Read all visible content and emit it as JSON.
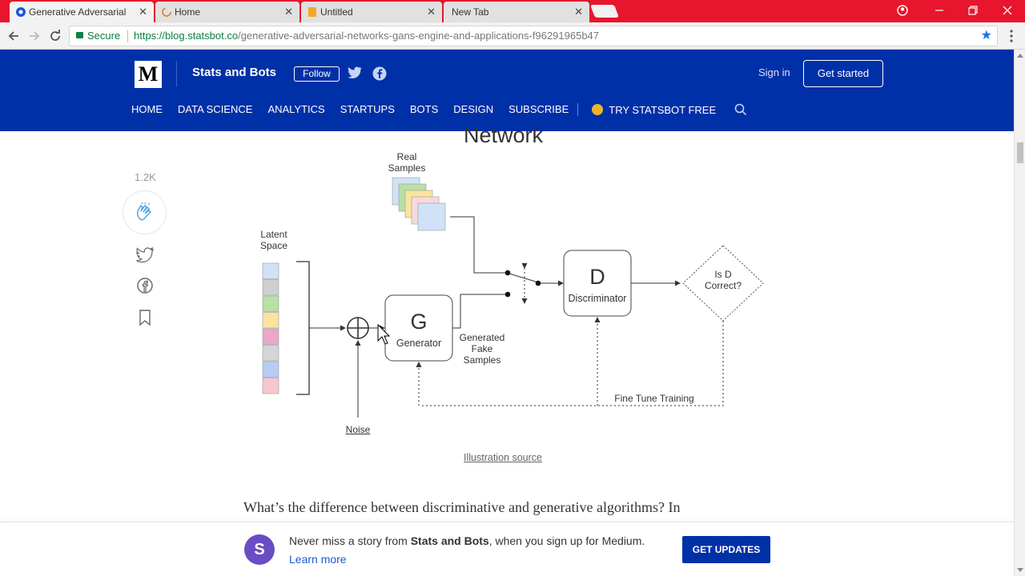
{
  "browser": {
    "tabs": [
      {
        "title": "Generative Adversarial N",
        "active": true
      },
      {
        "title": "Home",
        "active": false
      },
      {
        "title": "Untitled",
        "active": false
      },
      {
        "title": "New Tab",
        "active": false
      }
    ],
    "tab_close": "✕",
    "secure_label": "Secure",
    "url_host": "https://blog.statsbot.co",
    "url_path": "/generative-adversarial-networks-gans-engine-and-applications-f96291965b47"
  },
  "header": {
    "logo": "M",
    "publication": "Stats and Bots",
    "follow": "Follow",
    "sign_in": "Sign in",
    "get_started": "Get started",
    "nav": [
      "HOME",
      "DATA SCIENCE",
      "ANALYTICS",
      "STARTUPS",
      "BOTS",
      "DESIGN",
      "SUBSCRIBE"
    ],
    "try_label": "TRY STATSBOT FREE",
    "brand_color": "#0030a8"
  },
  "rail": {
    "clap_count": "1.2K"
  },
  "diagram": {
    "title": "Network",
    "real_samples": [
      "Real",
      "Samples"
    ],
    "latent_space": [
      "Latent",
      "Space"
    ],
    "generator_letter": "G",
    "generator_label": "Generator",
    "discriminator_letter": "D",
    "discriminator_label": "Discriminator",
    "is_correct": [
      "Is D",
      "Correct?"
    ],
    "generated": [
      "Generated",
      "Fake",
      "Samples"
    ],
    "noise": "Noise",
    "fine_tune": "Fine Tune Training",
    "caption": "Illustration source",
    "latent_colors": [
      "#cfe2f7",
      "#cfcfcf",
      "#b9e0a5",
      "#fbe3a0",
      "#e9a8c8",
      "#d5d5d5",
      "#b4cdf2",
      "#f7c6ce"
    ],
    "real_colors": [
      "#cfe2f7",
      "#b9e0a5",
      "#fbe3a0",
      "#f7d9d9",
      "#cfe2f7"
    ]
  },
  "article": {
    "paragraph_start": "What’s the difference between discriminative and generative algorithms? In"
  },
  "banner": {
    "avatar": "S",
    "text_pre": "Never miss a story from ",
    "text_pub": "Stats and Bots",
    "text_post": ", when you sign up for Medium. ",
    "learn_more": "Learn more",
    "button": "GET UPDATES"
  }
}
